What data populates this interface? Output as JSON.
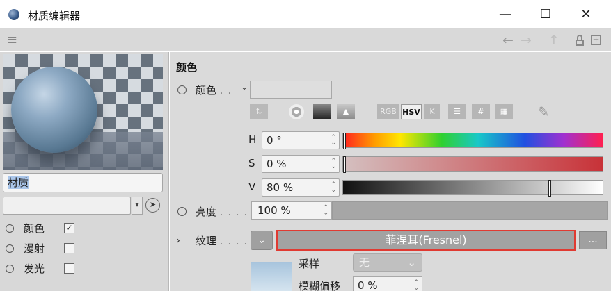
{
  "window": {
    "title": "材质编辑器",
    "controls": {
      "minimize": "—",
      "maximize": "☐",
      "close": "✕"
    }
  },
  "menubar": {
    "menu_glyph": "≡",
    "back": "←",
    "forward": "→",
    "up": "↑",
    "new_window": "+"
  },
  "left": {
    "material_name": "材质",
    "channels": [
      {
        "label": "颜色",
        "checked": true
      },
      {
        "label": "漫射",
        "checked": false
      },
      {
        "label": "发光",
        "checked": false
      }
    ],
    "checkmark": "✓"
  },
  "right": {
    "section_title": "颜色",
    "color_param": {
      "label": "颜色",
      "dots": ". .",
      "dropmark": "⌄"
    },
    "color_tools": {
      "rgb": "RGB",
      "hsv": "HSV",
      "k": "K",
      "hash": "#"
    },
    "hsv": [
      {
        "channel": "H",
        "value": "0 °",
        "level": 0.0
      },
      {
        "channel": "S",
        "value": "0 %",
        "level": 0.0
      },
      {
        "channel": "V",
        "value": "80 %",
        "level": 0.8
      }
    ],
    "brightness": {
      "label": "亮度",
      "dots": ". . . .",
      "value": "100 %"
    },
    "texture": {
      "expander": "›",
      "label": "纹理",
      "dots": ". . . .",
      "dropdown": "⌄",
      "shader": "菲涅耳(Fresnel)",
      "more": "..."
    },
    "sampling": {
      "label": "采样",
      "value": "无",
      "dropmark": "⌄"
    },
    "blur_offset": {
      "label": "模糊偏移",
      "value": "0 %"
    }
  },
  "colors": {
    "accent_red": "#e03a32",
    "selection_blue": "#aac6ea"
  }
}
